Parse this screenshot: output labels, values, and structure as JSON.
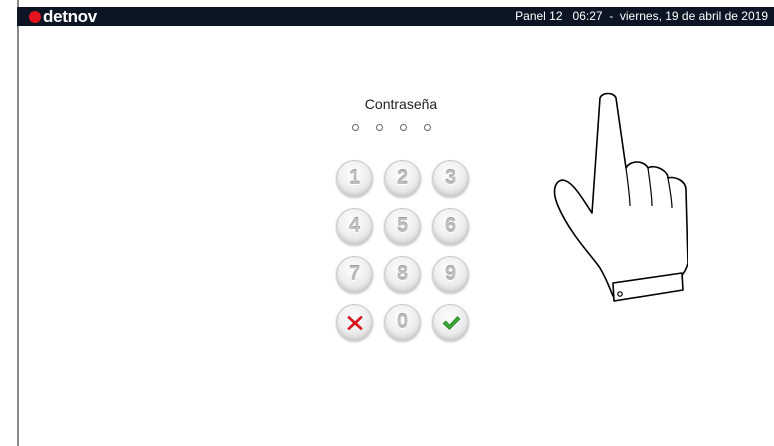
{
  "header": {
    "brand": "detnov",
    "info": "Panel 12   06:27  -  viernes, 19 de abril de 2019"
  },
  "login": {
    "title": "Contraseña",
    "pin_length": 4
  },
  "keypad": {
    "keys": [
      {
        "label": "1",
        "name": "key-1"
      },
      {
        "label": "2",
        "name": "key-2"
      },
      {
        "label": "3",
        "name": "key-3"
      },
      {
        "label": "4",
        "name": "key-4"
      },
      {
        "label": "5",
        "name": "key-5"
      },
      {
        "label": "6",
        "name": "key-6"
      },
      {
        "label": "7",
        "name": "key-7"
      },
      {
        "label": "8",
        "name": "key-8"
      },
      {
        "label": "9",
        "name": "key-9"
      },
      {
        "label": "",
        "name": "cancel-key",
        "icon": "x-icon"
      },
      {
        "label": "0",
        "name": "key-0"
      },
      {
        "label": "",
        "name": "confirm-key",
        "icon": "checkmark-icon"
      }
    ]
  },
  "colors": {
    "topbar": "#0b1524",
    "brand_red": "#e3141e",
    "cancel_red": "#e3141e",
    "confirm_green": "#3aa535",
    "digit_gray": "#bdbdbd"
  },
  "illustration": {
    "icon": "pointing-hand-icon"
  }
}
